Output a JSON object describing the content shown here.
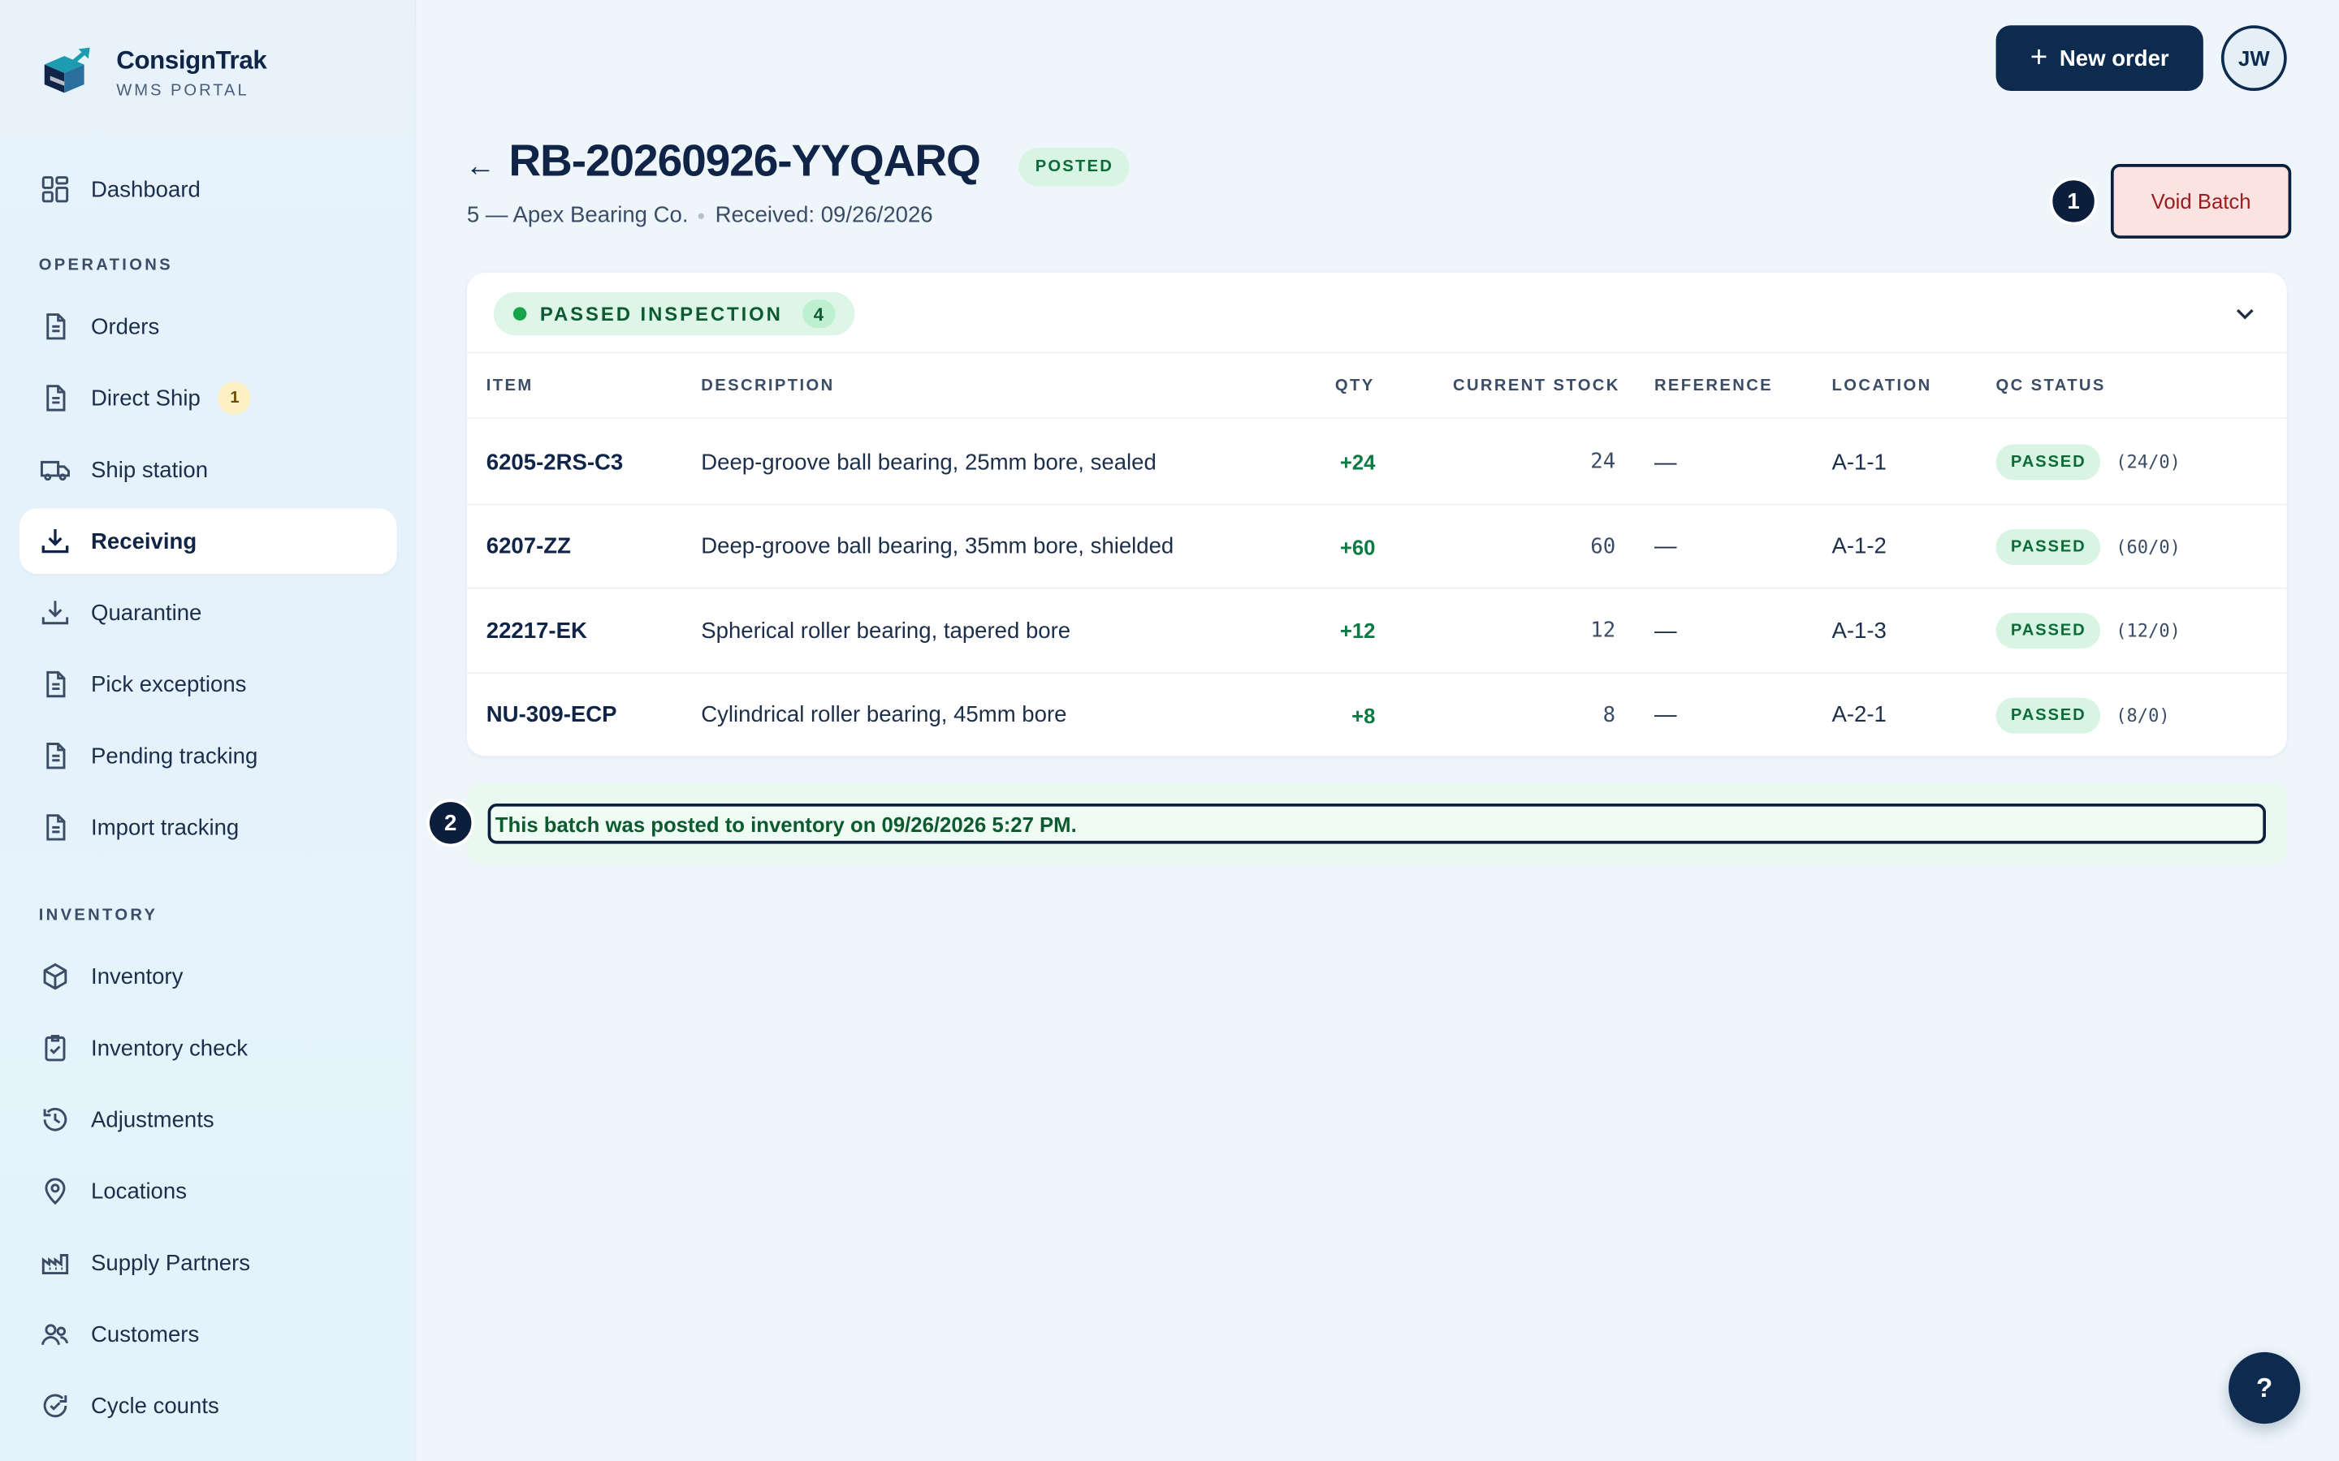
{
  "brand": {
    "name": "ConsignTrak",
    "sub": "WMS PORTAL"
  },
  "nav": {
    "dashboard": "Dashboard",
    "operations_label": "OPERATIONS",
    "orders": "Orders",
    "direct_ship": "Direct Ship",
    "direct_ship_badge": "1",
    "ship_station": "Ship station",
    "receiving": "Receiving",
    "quarantine": "Quarantine",
    "pick_exceptions": "Pick exceptions",
    "pending_tracking": "Pending tracking",
    "import_tracking": "Import tracking",
    "inventory_label": "INVENTORY",
    "inventory": "Inventory",
    "inventory_check": "Inventory check",
    "adjustments": "Adjustments",
    "locations": "Locations",
    "supply_partners": "Supply Partners",
    "customers": "Customers",
    "cycle_counts": "Cycle counts"
  },
  "topbar": {
    "new_order": "New order",
    "avatar": "JW"
  },
  "header": {
    "back": "←",
    "title": "RB-20260926-YYQARQ",
    "status": "POSTED",
    "supplier": "5 — Apex Bearing Co.",
    "received": "Received: 09/26/2026",
    "step1": "1",
    "void": "Void Batch"
  },
  "section": {
    "label": "PASSED INSPECTION",
    "count": "4"
  },
  "table": {
    "headers": {
      "item": "ITEM",
      "description": "DESCRIPTION",
      "qty": "QTY",
      "stock": "CURRENT STOCK",
      "reference": "REFERENCE",
      "location": "LOCATION",
      "qc": "QC STATUS"
    },
    "rows": [
      {
        "item": "6205-2RS-C3",
        "description": "Deep-groove ball bearing, 25mm bore, sealed",
        "qty": "+24",
        "stock": "24",
        "reference": "—",
        "location": "A-1-1",
        "qc": "PASSED",
        "ratio": "(24/0)"
      },
      {
        "item": "6207-ZZ",
        "description": "Deep-groove ball bearing, 35mm bore, shielded",
        "qty": "+60",
        "stock": "60",
        "reference": "—",
        "location": "A-1-2",
        "qc": "PASSED",
        "ratio": "(60/0)"
      },
      {
        "item": "22217-EK",
        "description": "Spherical roller bearing, tapered bore",
        "qty": "+12",
        "stock": "12",
        "reference": "—",
        "location": "A-1-3",
        "qc": "PASSED",
        "ratio": "(12/0)"
      },
      {
        "item": "NU-309-ECP",
        "description": "Cylindrical roller bearing, 45mm bore",
        "qty": "+8",
        "stock": "8",
        "reference": "—",
        "location": "A-2-1",
        "qc": "PASSED",
        "ratio": "(8/0)"
      }
    ]
  },
  "notice": {
    "step2": "2",
    "text": "This batch was posted to inventory on 09/26/2026 5:27 PM."
  },
  "help": "?",
  "colors": {
    "accent": "#0d2a4f",
    "success": "#0d6b39",
    "danger": "#9b1c1c"
  }
}
